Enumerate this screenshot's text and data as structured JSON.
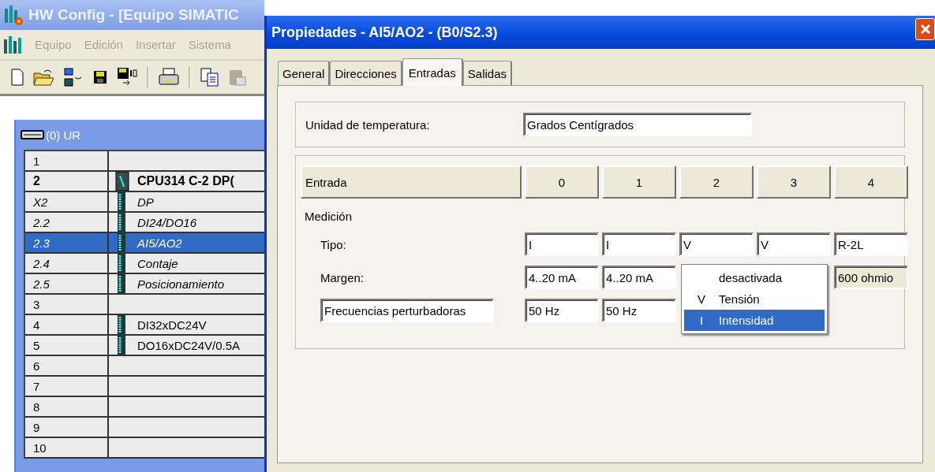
{
  "main_window": {
    "title": "HW Config - [Equipo SIMATIC",
    "menu": [
      {
        "label": "Equipo",
        "disabled": true
      },
      {
        "label": "Edición",
        "disabled": true
      },
      {
        "label": "Insertar",
        "disabled": true
      },
      {
        "label": "Sistema",
        "disabled": true
      }
    ],
    "rack": {
      "title": "(0) UR",
      "rows": [
        {
          "slot": "1",
          "kind": "empty",
          "selected": false
        },
        {
          "slot": "2",
          "module": "CPU314 C-2 DP(",
          "kind": "cpu",
          "selected": false
        },
        {
          "slot": "X2",
          "module": "DP",
          "kind": "submodule",
          "selected": false
        },
        {
          "slot": "2.2",
          "module": "DI24/DO16",
          "kind": "submodule",
          "selected": false
        },
        {
          "slot": "2.3",
          "module": "AI5/AO2",
          "kind": "submodule",
          "selected": true
        },
        {
          "slot": "2.4",
          "module": "Contaje",
          "kind": "submodule",
          "selected": false
        },
        {
          "slot": "2.5",
          "module": "Posicionamiento",
          "kind": "submodule",
          "selected": false
        },
        {
          "slot": "3",
          "kind": "empty",
          "selected": false
        },
        {
          "slot": "4",
          "module": "DI32xDC24V",
          "kind": "module",
          "selected": false
        },
        {
          "slot": "5",
          "module": "DO16xDC24V/0.5A",
          "kind": "module",
          "selected": false
        },
        {
          "slot": "6",
          "kind": "empty",
          "selected": false
        },
        {
          "slot": "7",
          "kind": "empty",
          "selected": false
        },
        {
          "slot": "8",
          "kind": "empty",
          "selected": false
        },
        {
          "slot": "9",
          "kind": "empty",
          "selected": false
        },
        {
          "slot": "10",
          "kind": "empty",
          "selected": false
        }
      ]
    }
  },
  "dialog": {
    "title": "Propiedades - AI5/AO2 - (B0/S2.3)",
    "tabs": [
      {
        "label": "General",
        "selected": false
      },
      {
        "label": "Direcciones",
        "selected": false
      },
      {
        "label": "Entradas",
        "selected": true
      },
      {
        "label": "Salidas",
        "selected": false
      }
    ],
    "temperature_unit": {
      "label": "Unidad de temperatura:",
      "value": "Grados Centígrados"
    },
    "inputs_table": {
      "columns": [
        "Entrada",
        "0",
        "1",
        "2",
        "3",
        "4"
      ],
      "rows": [
        {
          "kind": "heading",
          "label": "Medición"
        },
        {
          "kind": "parameter",
          "label": "Tipo:",
          "cells": [
            {
              "value": "I",
              "disabled": false
            },
            {
              "value": "I",
              "disabled": false
            },
            {
              "value": "V",
              "disabled": false
            },
            {
              "value": "V",
              "disabled": false
            },
            {
              "value": "R-2L",
              "disabled": false
            }
          ]
        },
        {
          "kind": "parameter",
          "label": "Margen:",
          "cells": [
            {
              "value": "4..20 mA",
              "disabled": false
            },
            {
              "value": "4..20 mA",
              "disabled": false
            },
            null,
            null,
            {
              "value": "600 ohmio",
              "disabled": true
            }
          ]
        },
        {
          "kind": "field_parameter",
          "label": "Frecuencias perturbadoras",
          "cells": [
            {
              "value": "50 Hz",
              "disabled": false
            },
            {
              "value": "50 Hz",
              "disabled": false
            },
            null,
            null,
            null
          ]
        }
      ]
    },
    "dropdown": {
      "items": [
        {
          "label": "desactivada",
          "selected": false
        },
        {
          "key": "V",
          "label": "Tensión",
          "selected": false
        },
        {
          "key": "I",
          "label": "Intensidad",
          "selected": true
        }
      ]
    }
  }
}
